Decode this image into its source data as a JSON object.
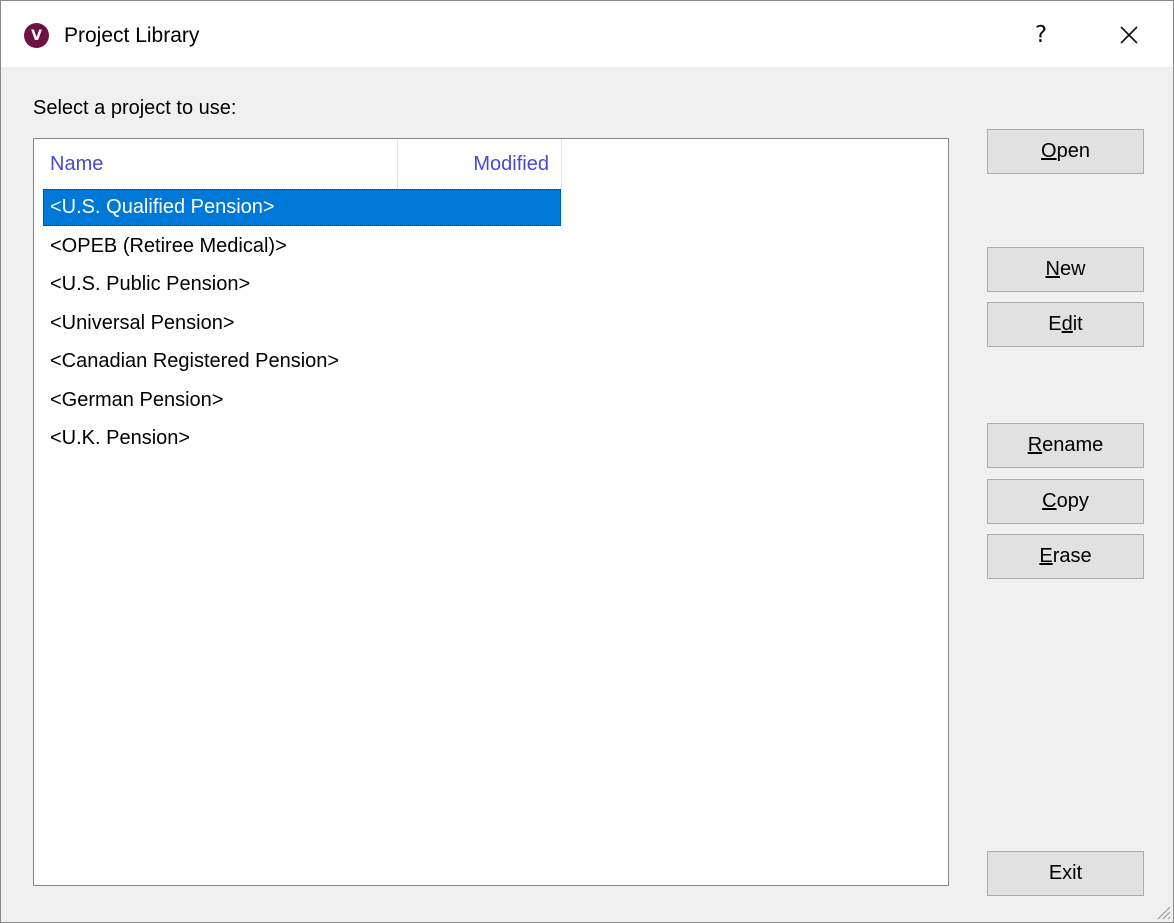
{
  "window": {
    "title": "Project Library",
    "app_icon_letter": "V",
    "help_label": "?",
    "close_label": "✕"
  },
  "prompt": "Select a project to use:",
  "list": {
    "columns": [
      "Name",
      "Modified"
    ],
    "rows": [
      {
        "name": "<U.S. Qualified Pension>",
        "modified": "",
        "selected": true
      },
      {
        "name": "<OPEB (Retiree Medical)>",
        "modified": "",
        "selected": false
      },
      {
        "name": "<U.S. Public Pension>",
        "modified": "",
        "selected": false
      },
      {
        "name": "<Universal Pension>",
        "modified": "",
        "selected": false
      },
      {
        "name": "<Canadian Registered Pension>",
        "modified": "",
        "selected": false
      },
      {
        "name": "<German Pension>",
        "modified": "",
        "selected": false
      },
      {
        "name": "<U.K. Pension>",
        "modified": "",
        "selected": false
      }
    ]
  },
  "buttons": {
    "open": {
      "key": "O",
      "rest": "pen"
    },
    "new": {
      "key": "N",
      "rest": "ew"
    },
    "edit": {
      "pre": "E",
      "key": "d",
      "rest": "it"
    },
    "rename": {
      "key": "R",
      "rest": "ename"
    },
    "copy": {
      "key": "C",
      "rest": "opy"
    },
    "erase": {
      "key": "E",
      "rest": "rase"
    },
    "exit": {
      "label": "Exit"
    }
  },
  "colors": {
    "selection": "#0078d7",
    "header_text": "#4a4ad0",
    "app_icon": "#6b1240"
  }
}
